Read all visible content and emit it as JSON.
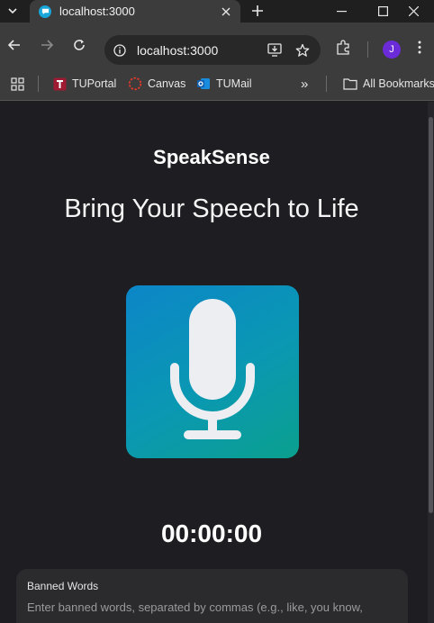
{
  "browser": {
    "tab": {
      "title": "localhost:3000"
    },
    "omnibox": {
      "url": "localhost:3000"
    },
    "profile_initial": "J",
    "bookmarks": [
      {
        "label": "TUPortal",
        "icon": "tuportal-icon"
      },
      {
        "label": "Canvas",
        "icon": "canvas-icon"
      },
      {
        "label": "TUMail",
        "icon": "outlook-icon"
      }
    ],
    "bookmarks_overflow": "»",
    "all_bookmarks": "All Bookmarks"
  },
  "app": {
    "brand": "SpeakSense",
    "headline": "Bring Your Speech to Life",
    "mic_icon": "microphone-icon",
    "timer": "00:00:00",
    "banned_words": {
      "label": "Banned Words",
      "placeholder": "Enter banned words, separated by commas (e.g., like, you know,"
    }
  },
  "colors": {
    "page_bg": "#1e1d21",
    "mic_gradient_start": "#0c86c8",
    "mic_gradient_end": "#0aa08e",
    "profile": "#6b2bd9"
  }
}
